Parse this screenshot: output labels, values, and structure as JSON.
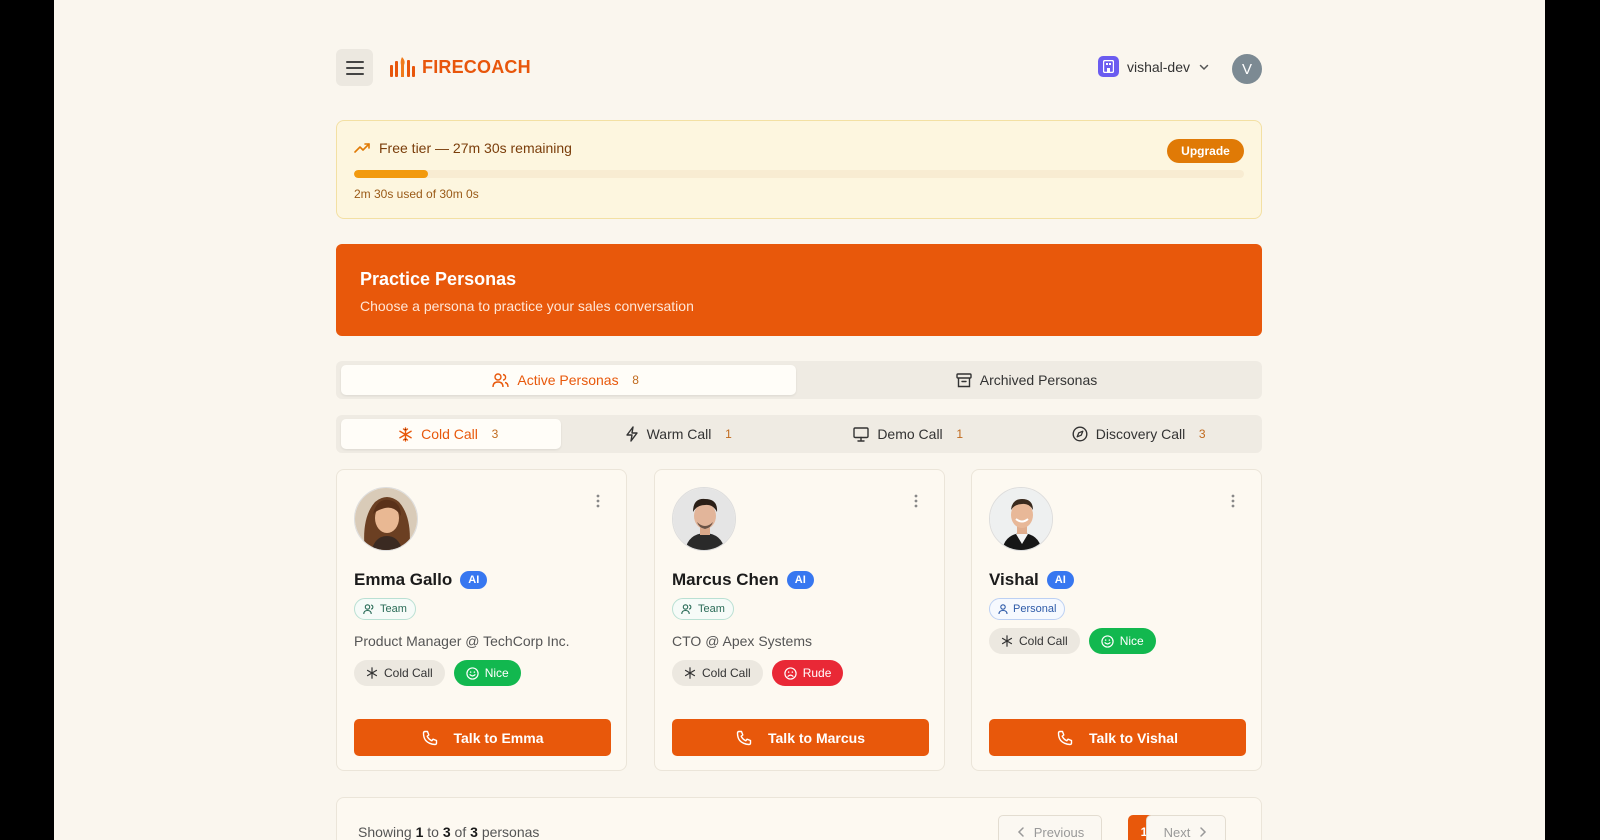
{
  "header": {
    "brand": "FIRECOACH",
    "org": "vishal-dev",
    "avatar_initial": "V"
  },
  "tier": {
    "title": "Free tier — 27m 30s remaining",
    "usage": "2m 30s used of 30m 0s",
    "used_fraction": 0.083,
    "upgrade_label": "Upgrade"
  },
  "banner": {
    "title": "Practice Personas",
    "subtitle": "Choose a persona to practice your sales conversation"
  },
  "status_tabs": {
    "active": {
      "label": "Active Personas",
      "count": "8"
    },
    "archived": {
      "label": "Archived Personas"
    }
  },
  "type_tabs": [
    {
      "label": "Cold Call",
      "count": "3",
      "icon": "snowflake-icon"
    },
    {
      "label": "Warm Call",
      "count": "1",
      "icon": "zap-icon"
    },
    {
      "label": "Demo Call",
      "count": "1",
      "icon": "monitor-icon"
    },
    {
      "label": "Discovery Call",
      "count": "3",
      "icon": "compass-icon"
    }
  ],
  "personas": [
    {
      "name": "Emma Gallo",
      "badge": "AI",
      "scope": "Team",
      "role": "Product Manager @ TechCorp Inc.",
      "call_type": "Cold Call",
      "mood": "Nice",
      "cta": "Talk to Emma"
    },
    {
      "name": "Marcus Chen",
      "badge": "AI",
      "scope": "Team",
      "role": "CTO @ Apex Systems",
      "call_type": "Cold Call",
      "mood": "Rude",
      "cta": "Talk to Marcus"
    },
    {
      "name": "Vishal",
      "badge": "AI",
      "scope": "Personal",
      "role": "",
      "call_type": "Cold Call",
      "mood": "Nice",
      "cta": "Talk to Vishal"
    }
  ],
  "pagination": {
    "showing_prefix": "Showing",
    "from": "1",
    "to_word": "to",
    "to": "3",
    "of_word": "of",
    "total": "3",
    "suffix": "personas",
    "previous": "Previous",
    "current": "1",
    "next": "Next"
  },
  "colors": {
    "brand": "#e8580b",
    "tier_fill": "#f29a0e",
    "nice": "#12b84f",
    "rude": "#e92836",
    "ai_badge": "#3777f0"
  }
}
